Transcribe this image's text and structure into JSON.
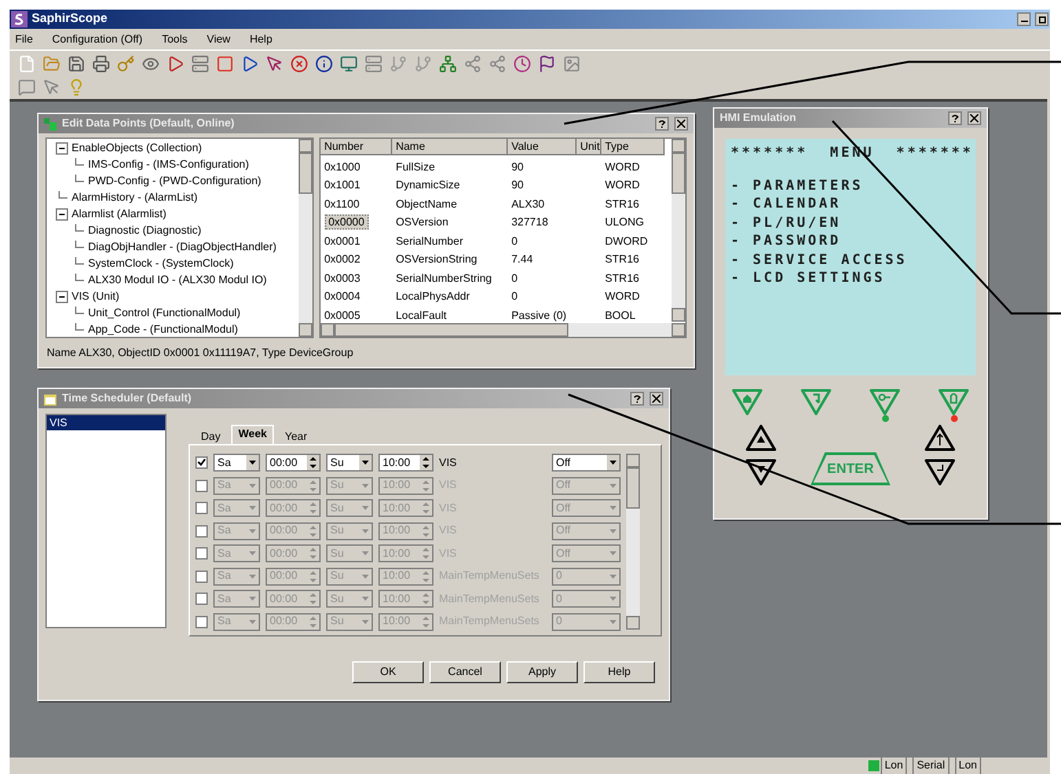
{
  "window": {
    "title": "SaphirScope"
  },
  "menu": [
    {
      "label": "File"
    },
    {
      "label": "Configuration (Off)"
    },
    {
      "label": "Tools"
    },
    {
      "label": "View"
    },
    {
      "label": "Help"
    }
  ],
  "edit_data_points": {
    "title": "Edit Data Points (Default, Online)",
    "tree": [
      {
        "label": "EnableObjects   (Collection)",
        "children": [
          {
            "label": "IMS-Config - (IMS-Configuration)"
          },
          {
            "label": "PWD-Config - (PWD-Configuration)"
          }
        ]
      },
      {
        "label": "AlarmHistory - (AlarmList)"
      },
      {
        "label": "Alarmlist   (Alarmlist)",
        "children": [
          {
            "label": "Diagnostic   (Diagnostic)"
          },
          {
            "label": "DiagObjHandler - (DiagObjectHandler)"
          },
          {
            "label": "SystemClock - (SystemClock)"
          },
          {
            "label": "ALX30 Modul IO - (ALX30 Modul IO)"
          }
        ]
      },
      {
        "label": "VIS   (Unit)",
        "children": [
          {
            "label": "Unit_Control   (FunctionalModul)"
          },
          {
            "label": "App_Code - (FunctionalModul)"
          }
        ]
      }
    ],
    "columns": [
      "Number",
      "Name",
      "Value",
      "Unit",
      "Type"
    ],
    "rows": [
      {
        "number": "0x1000",
        "name": "FullSize",
        "value": "90",
        "unit": "",
        "type": "WORD",
        "selected": false
      },
      {
        "number": "0x1001",
        "name": "DynamicSize",
        "value": "90",
        "unit": "",
        "type": "WORD",
        "selected": false
      },
      {
        "number": "0x1100",
        "name": "ObjectName",
        "value": "ALX30",
        "unit": "",
        "type": "STR16",
        "selected": false
      },
      {
        "number": "0x0000",
        "name": "OSVersion",
        "value": "327718",
        "unit": "",
        "type": "ULONG",
        "selected": true
      },
      {
        "number": "0x0001",
        "name": "SerialNumber",
        "value": "0",
        "unit": "",
        "type": "DWORD",
        "selected": false
      },
      {
        "number": "0x0002",
        "name": "OSVersionString",
        "value": "7.44",
        "unit": "",
        "type": "STR16",
        "selected": false
      },
      {
        "number": "0x0003",
        "name": "SerialNumberString",
        "value": "0",
        "unit": "",
        "type": "STR16",
        "selected": false
      },
      {
        "number": "0x0004",
        "name": "LocalPhysAddr",
        "value": "0",
        "unit": "",
        "type": "WORD",
        "selected": false
      },
      {
        "number": "0x0005",
        "name": "LocalFault",
        "value": "Passive (0)",
        "unit": "",
        "type": "BOOL",
        "selected": false
      }
    ],
    "status": "Name ALX30, ObjectID 0x0001 0x11119A7, Type DeviceGroup"
  },
  "hmi_emulation": {
    "title": "HMI Emulation",
    "lcd_lines": [
      "*******  MENU  *******",
      "- PARAMETERS",
      "- CALENDAR",
      "- PL/RU/EN",
      "- PASSWORD",
      "- SERVICE ACCESS",
      "- LCD SETTINGS"
    ],
    "function_keys": [
      {
        "kind": "home"
      },
      {
        "kind": "back"
      },
      {
        "kind": "key",
        "color": "#22aa44"
      },
      {
        "kind": "bell",
        "color": "#ee3322"
      }
    ],
    "enter_label": "ENTER"
  },
  "time_scheduler": {
    "title": "Time Scheduler (Default)",
    "list": [
      {
        "label": "VIS",
        "selected": true
      }
    ],
    "tabs": [
      {
        "label": "Day",
        "selected": false
      },
      {
        "label": "Week",
        "selected": true
      },
      {
        "label": "Year",
        "selected": false
      }
    ],
    "rows": [
      {
        "checked": true,
        "from_day": "Sa",
        "from_time": "00:00",
        "to_day": "Su",
        "to_time": "10:00",
        "name": "VIS",
        "value": "Off"
      },
      {
        "checked": false,
        "from_day": "Sa",
        "from_time": "00:00",
        "to_day": "Su",
        "to_time": "10:00",
        "name": "VIS",
        "value": "Off"
      },
      {
        "checked": false,
        "from_day": "Sa",
        "from_time": "00:00",
        "to_day": "Su",
        "to_time": "10:00",
        "name": "VIS",
        "value": "Off"
      },
      {
        "checked": false,
        "from_day": "Sa",
        "from_time": "00:00",
        "to_day": "Su",
        "to_time": "10:00",
        "name": "VIS",
        "value": "Off"
      },
      {
        "checked": false,
        "from_day": "Sa",
        "from_time": "00:00",
        "to_day": "Su",
        "to_time": "10:00",
        "name": "VIS",
        "value": "Off"
      },
      {
        "checked": false,
        "from_day": "Sa",
        "from_time": "00:00",
        "to_day": "Su",
        "to_time": "10:00",
        "name": "MainTempMenuSets",
        "value": "0"
      },
      {
        "checked": false,
        "from_day": "Sa",
        "from_time": "00:00",
        "to_day": "Su",
        "to_time": "10:00",
        "name": "MainTempMenuSets",
        "value": "0"
      },
      {
        "checked": false,
        "from_day": "Sa",
        "from_time": "00:00",
        "to_day": "Su",
        "to_time": "10:00",
        "name": "MainTempMenuSets",
        "value": "0"
      }
    ],
    "buttons": [
      "OK",
      "Cancel",
      "Apply",
      "Help"
    ]
  },
  "status_bar": [
    {
      "label": "Lon",
      "kind": "led"
    },
    {
      "label": "Serial",
      "kind": "text"
    },
    {
      "label": "Lon",
      "kind": "text"
    }
  ]
}
